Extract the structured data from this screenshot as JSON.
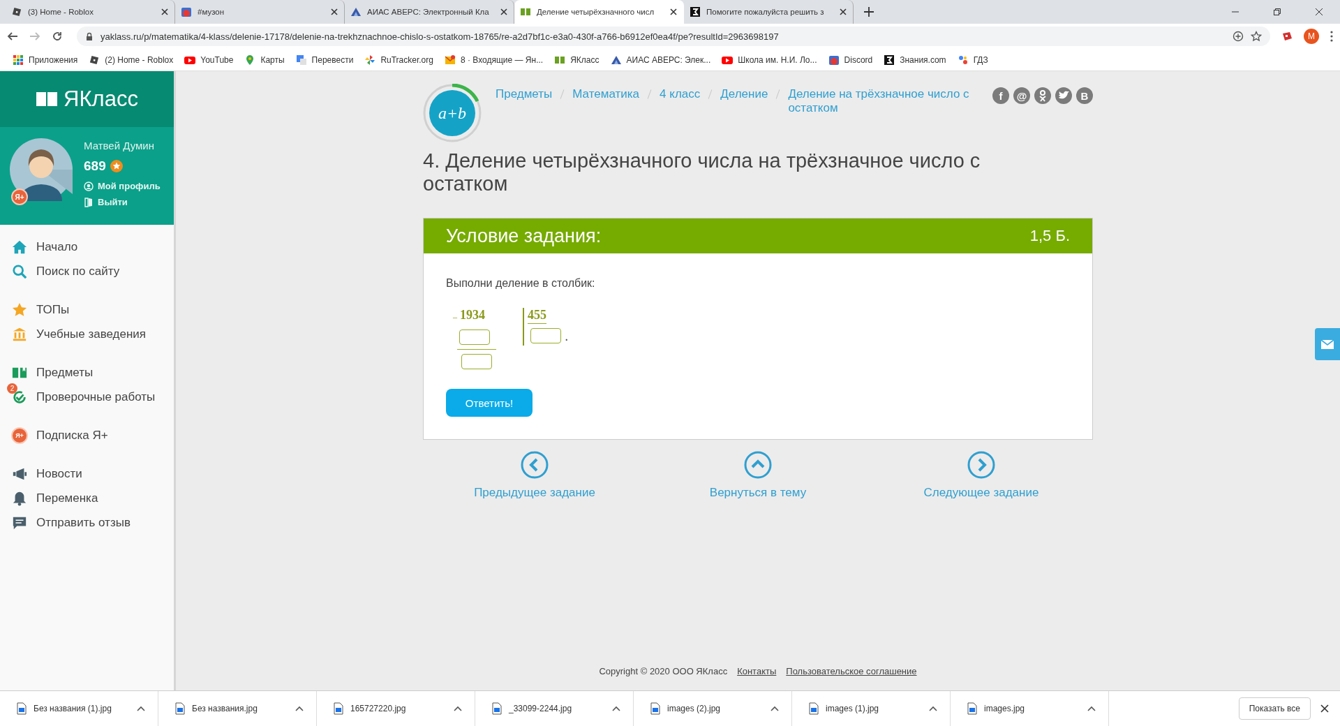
{
  "browser": {
    "tabs": [
      {
        "title": "(3) Home - Roblox",
        "selected": false
      },
      {
        "title": "#музон",
        "selected": false
      },
      {
        "title": "АИАС АВЕРС: Электронный Кла",
        "selected": false
      },
      {
        "title": "Деление четырёхзначного числ",
        "selected": true
      },
      {
        "title": "Помогите пожалуйста решить з",
        "selected": false
      }
    ],
    "url": "yaklass.ru/p/matematika/4-klass/delenie-17178/delenie-na-trekhznachnoe-chislo-s-ostatkom-18765/re-a2d7bf1c-e3a0-430f-a766-b6912ef0ea4f/pe?resultId=2963698197",
    "profile_initial": "M",
    "bookmarks": [
      "Приложения",
      "(2) Home - Roblox",
      "YouTube",
      "Карты",
      "Перевести",
      "RuTracker.org",
      "8 · Входящие — Ян...",
      "ЯКласс",
      "АИАС АВЕРС: Элек...",
      "Школа им. Н.И. Ло...",
      "Discord",
      "Знания.com",
      "ГДЗ"
    ]
  },
  "sidebar": {
    "logo": "ЯКласс",
    "user": {
      "badge": "Я+",
      "name": "Матвей Думин",
      "points": "689",
      "links": [
        "Мой профиль",
        "Выйти"
      ]
    },
    "nav_groups": [
      [
        {
          "label": "Начало"
        },
        {
          "label": "Поиск по сайту"
        }
      ],
      [
        {
          "label": "ТОПы"
        },
        {
          "label": "Учебные заведения"
        }
      ],
      [
        {
          "label": "Предметы"
        },
        {
          "label": "Проверочные работы",
          "badge": "2"
        }
      ],
      [
        {
          "label": "Подписка Я+",
          "icon_text": "Я+"
        }
      ],
      [
        {
          "label": "Новости"
        },
        {
          "label": "Переменка"
        },
        {
          "label": "Отправить отзыв"
        }
      ]
    ]
  },
  "topic_icon": "a+b",
  "breadcrumbs": [
    "Предметы",
    "Математика",
    "4 класс",
    "Деление",
    "Деление на трёхзначное число с остатком"
  ],
  "social": [
    {
      "kind": "text",
      "label": "f"
    },
    {
      "kind": "text",
      "label": "@"
    },
    {
      "kind": "icon"
    },
    {
      "kind": "icon"
    },
    {
      "kind": "text",
      "label": "B"
    }
  ],
  "title": "4. Деление четырёхзначного числа на трёхзначное число с остатком",
  "task": {
    "header": "Условие задания:",
    "points": "1,5 Б.",
    "prompt": "Выполни деление в столбик:",
    "operator": "–",
    "dividend": "1934",
    "divisor": "455",
    "quotient_dot": ".",
    "submit": "Ответить!"
  },
  "navigation": [
    "Предыдущее задание",
    "Вернуться в тему",
    "Следующее задание"
  ],
  "footer": {
    "copyright": "Copyright © 2020 ООО ЯКласс",
    "links": [
      "Контакты",
      "Пользовательское соглашение"
    ]
  },
  "downloads": {
    "files": [
      "Без названия (1).jpg",
      "Без названия.jpg",
      "165727220.jpg",
      "_33099-2244.jpg",
      "images (2).jpg",
      "images (1).jpg",
      "images.jpg"
    ],
    "show_all": "Показать все"
  }
}
